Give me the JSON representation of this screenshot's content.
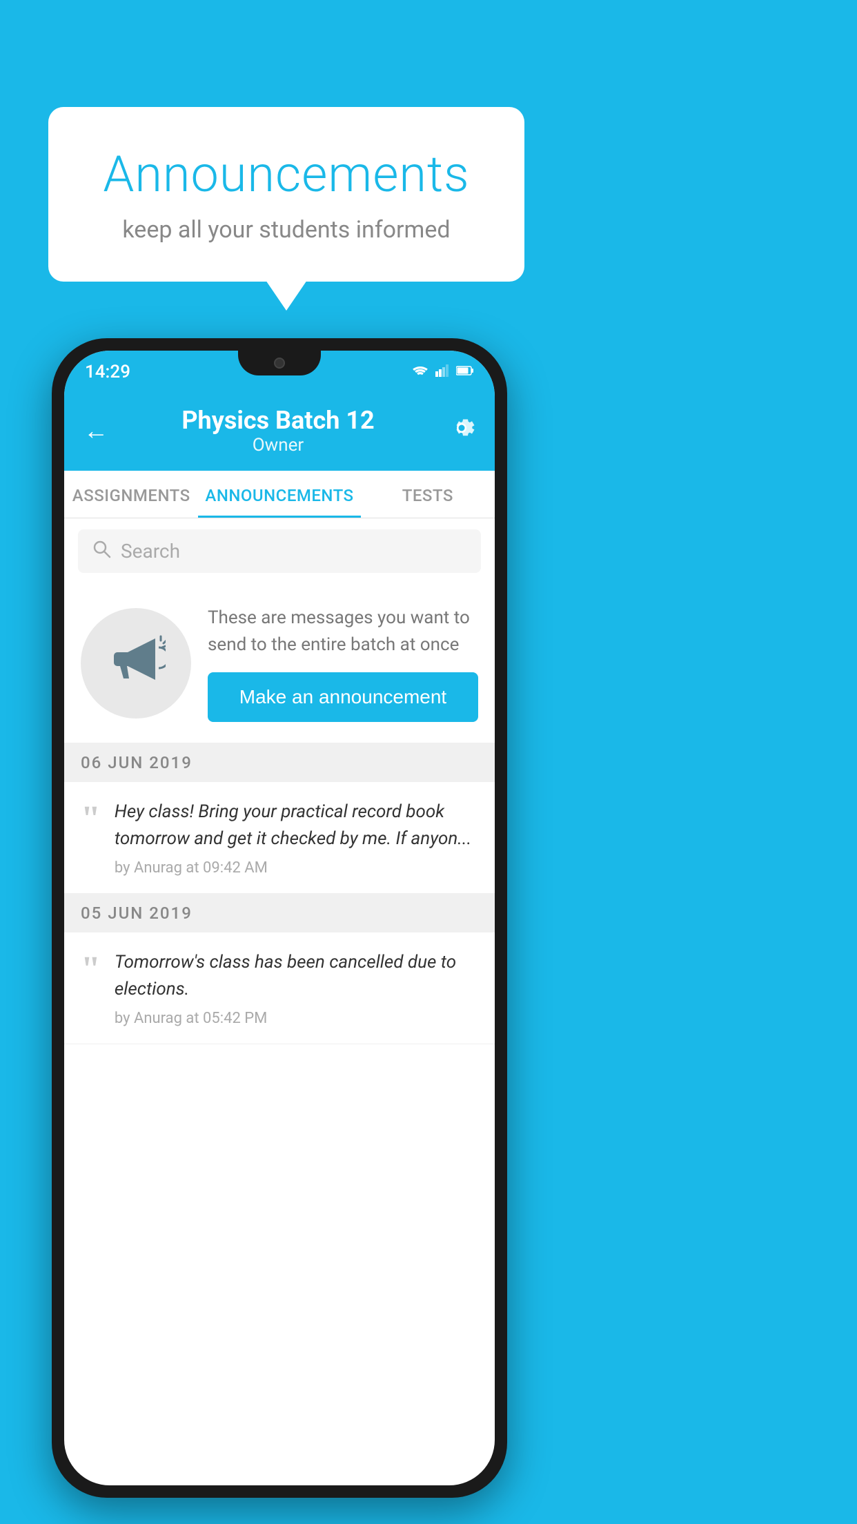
{
  "background_color": "#1ab8e8",
  "speech_bubble": {
    "title": "Announcements",
    "subtitle": "keep all your students informed"
  },
  "phone": {
    "status_bar": {
      "time": "14:29",
      "wifi": "▼",
      "signal": "▲",
      "battery": "█"
    },
    "header": {
      "title": "Physics Batch 12",
      "subtitle": "Owner",
      "back_label": "←",
      "settings_label": "⚙"
    },
    "tabs": [
      {
        "label": "ASSIGNMENTS",
        "active": false
      },
      {
        "label": "ANNOUNCEMENTS",
        "active": true
      },
      {
        "label": "TESTS",
        "active": false
      }
    ],
    "search": {
      "placeholder": "Search"
    },
    "announcement_prompt": {
      "description": "These are messages you want to send to the entire batch at once",
      "button_label": "Make an announcement"
    },
    "date_groups": [
      {
        "date": "06  JUN  2019",
        "announcements": [
          {
            "text": "Hey class! Bring your practical record book tomorrow and get it checked by me. If anyon...",
            "meta": "by Anurag at 09:42 AM"
          }
        ]
      },
      {
        "date": "05  JUN  2019",
        "announcements": [
          {
            "text": "Tomorrow's class has been cancelled due to elections.",
            "meta": "by Anurag at 05:42 PM"
          }
        ]
      }
    ]
  }
}
